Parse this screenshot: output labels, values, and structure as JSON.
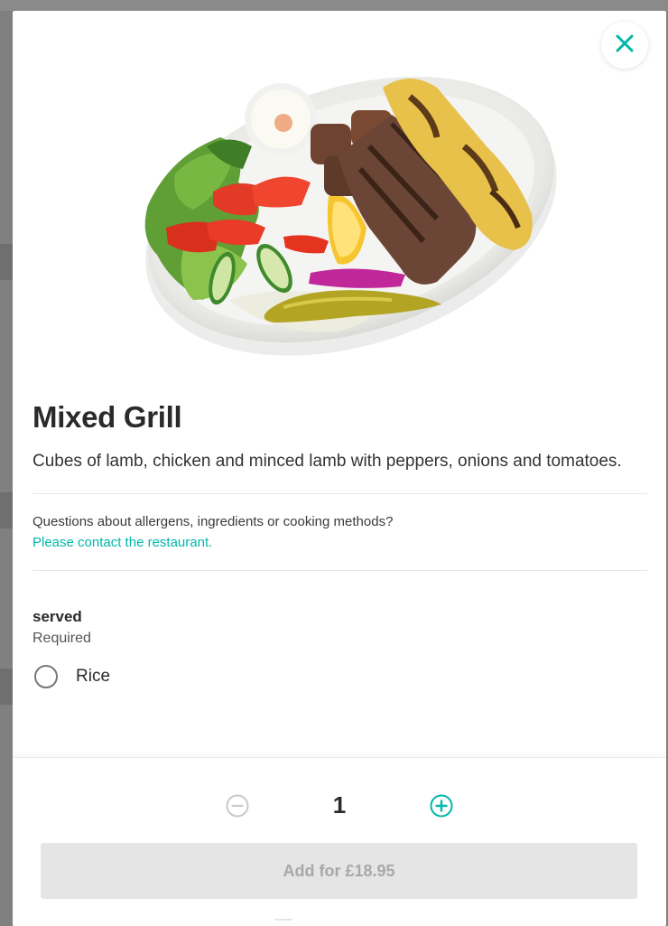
{
  "item": {
    "title": "Mixed Grill",
    "description": "Cubes of lamb, chicken and minced lamb with peppers, onions and tomatoes.",
    "image_alt": "mixed-grill-plate"
  },
  "allergens": {
    "question": "Questions about allergens, ingredients or cooking methods?",
    "link": "Please contact the restaurant."
  },
  "options": {
    "group_title": "served",
    "required_label": "Required",
    "choices": [
      "Rice"
    ],
    "selected": null
  },
  "quantity": {
    "value": "1"
  },
  "cart": {
    "add_label": "Add for £18.95",
    "enabled": false
  },
  "icons": {
    "close": "close-icon",
    "minus": "minus-circle-icon",
    "plus": "plus-circle-icon"
  },
  "colors": {
    "accent": "#00b8a9",
    "disabled_button_bg": "#e5e5e5",
    "disabled_button_text": "#a8a8a8",
    "backdrop": "#808080"
  }
}
